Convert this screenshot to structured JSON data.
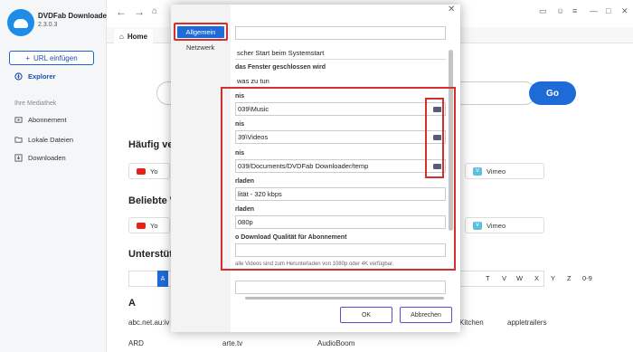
{
  "app": {
    "name": "DVDFab Downloader",
    "version": "2.3.0.3"
  },
  "sidebar": {
    "url_button": "URL einfügen",
    "explorer": "Explorer",
    "section": "Ihre Mediathek",
    "items": [
      {
        "label": "Abonnement"
      },
      {
        "label": "Lokale Dateien"
      },
      {
        "label": "Downloaden"
      }
    ]
  },
  "tabs": {
    "home": "Home"
  },
  "main": {
    "go_label": "Go",
    "section1": "Häufig ve",
    "section2": "Beliebte W",
    "section3": "Unterstüt",
    "pill_youtube": "Yo",
    "pill_vimeo": "Vimeo",
    "alpha_selected": "A",
    "letters": [
      "T",
      "V",
      "W",
      "X",
      "Y",
      "Z",
      "0-9"
    ],
    "letter_heading": "A",
    "sites": [
      "abc.net.au:iv",
      "Kitchen",
      "appletrailers",
      "ARD",
      "arte.tv",
      "AudioBoom"
    ]
  },
  "dialog": {
    "tabs": {
      "general": "Allgemein",
      "network": "Netzwerk"
    },
    "rows": [
      {
        "label": "",
        "value": ""
      },
      {
        "label": "",
        "value": "scher Start beim Systemstart"
      },
      {
        "label": "das Fenster geschlossen wird",
        "value": "was zu tun"
      },
      {
        "label": "nis",
        "value": "039\\Music"
      },
      {
        "label": "nis",
        "value": "39\\Videos"
      },
      {
        "label": "nis",
        "value": "039/Documents/DVDFab Downloader/temp"
      },
      {
        "label": "rladen",
        "value": "lität - 320 kbps"
      },
      {
        "label": "rladen",
        "value": "080p"
      },
      {
        "label": "o Download Qualität für Abonnement",
        "value": ""
      }
    ],
    "note": "alle Videos sind zum Herunterladen von 1080p oder 4K verfügbar.",
    "ok": "OK",
    "cancel": "Abbrechen"
  }
}
